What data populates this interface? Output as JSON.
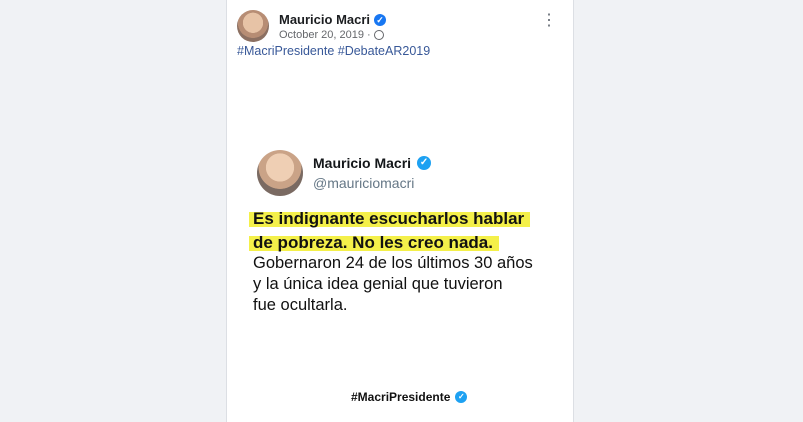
{
  "post": {
    "author": "Mauricio Macri",
    "date": "October 20, 2019",
    "more_icon": "more-options-icon",
    "hashtags": [
      "#MacriPresidente",
      "#DebateAR2019"
    ]
  },
  "tweet": {
    "name": "Mauricio Macri",
    "handle": "@mauriciomacri",
    "highlight_lines": [
      "Es indignante escucharlos hablar",
      "de pobreza. No les creo nada."
    ],
    "body_lines": [
      "Gobernaron 24 de los últimos 30 años",
      "y la única idea genial que tuvieron",
      "fue ocultarla."
    ],
    "footer_tag": "#MacriPresidente"
  },
  "colors": {
    "facebook_blue": "#1877f2",
    "hashtag_link": "#385898",
    "twitter_blue": "#1da1f2",
    "highlight_yellow": "#f4f04a"
  }
}
